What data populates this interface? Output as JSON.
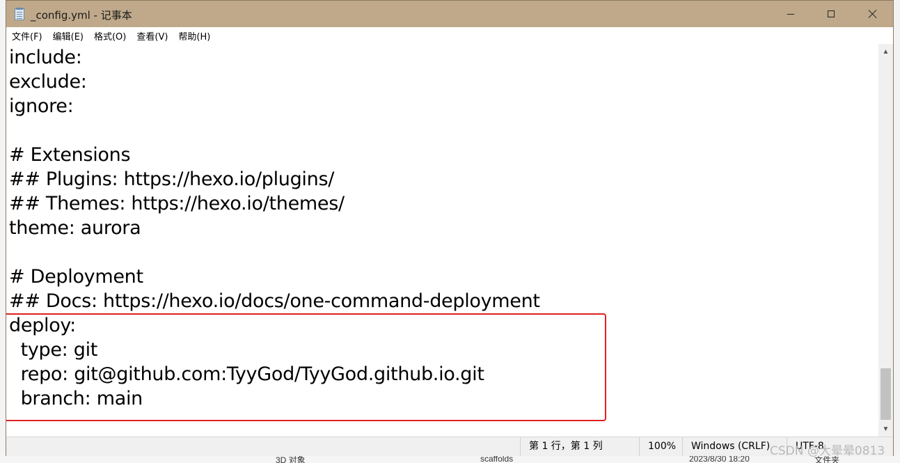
{
  "window": {
    "title": "_config.yml - 记事本"
  },
  "menu": [
    "文件(F)",
    "编辑(E)",
    "格式(O)",
    "查看(V)",
    "帮助(H)"
  ],
  "editor": {
    "lines": [
      "include:",
      "exclude:",
      "ignore:",
      "",
      "# Extensions",
      "## Plugins: https://hexo.io/plugins/",
      "## Themes: https://hexo.io/themes/",
      "theme: aurora",
      "",
      "# Deployment",
      "## Docs: https://hexo.io/docs/one-command-deployment",
      "deploy:",
      "  type: git",
      "  repo: git@github.com:TyyGod/TyyGod.github.io.git",
      "  branch: main"
    ]
  },
  "status": {
    "position": "第 1 行，第 1 列",
    "zoom": "100%",
    "line_ending": "Windows (CRLF)",
    "encoding": "UTF-8"
  },
  "background": {
    "explorer_item_1": "3D 对象",
    "explorer_item_2": "scaffolds",
    "explorer_date": "2023/8/30 18:20",
    "explorer_type": "文件夹"
  },
  "watermark": "CSDN @大晕晕0813",
  "colors": {
    "titlebar": "#bfa98a",
    "highlight_border": "#e02020"
  }
}
